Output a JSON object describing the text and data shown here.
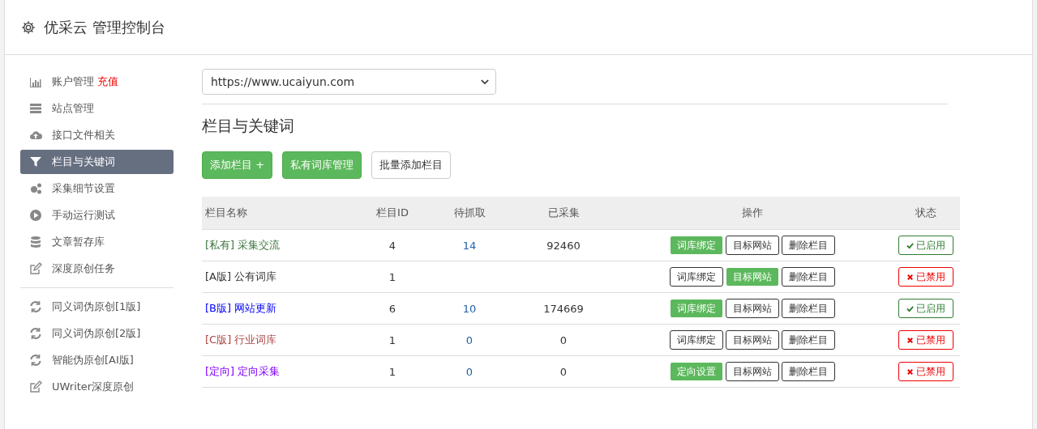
{
  "header": {
    "title": "优采云 管理控制台"
  },
  "sidebar": {
    "items": [
      {
        "label": "账户管理",
        "badge": "充值",
        "selected": false
      },
      {
        "label": "站点管理",
        "selected": false
      },
      {
        "label": "接口文件相关",
        "selected": false
      },
      {
        "label": "栏目与关键词",
        "selected": true
      },
      {
        "label": "采集细节设置",
        "selected": false
      },
      {
        "label": "手动运行测试",
        "selected": false
      },
      {
        "label": "文章暂存库",
        "selected": false
      },
      {
        "label": "深度原创任务",
        "selected": false
      }
    ],
    "tools": [
      {
        "kind": "refresh",
        "label": "同义词伪原创[1版]"
      },
      {
        "kind": "refresh",
        "label": "同义词伪原创[2版]"
      },
      {
        "kind": "refresh",
        "label": "智能伪原创[AI版]"
      },
      {
        "kind": "edit",
        "label": "UWriter深度原创"
      }
    ]
  },
  "site_select": {
    "value": "https://www.ucaiyun.com"
  },
  "section_title": "栏目与关键词",
  "toolbar": [
    {
      "label": "添加栏目 +",
      "kind": "primary"
    },
    {
      "label": "私有词库管理",
      "kind": "primary"
    },
    {
      "label": "批量添加栏目",
      "kind": "default"
    }
  ],
  "table": {
    "columns": [
      "栏目名称",
      "栏目ID",
      "待抓取",
      "已采集",
      "操作",
      "状态"
    ],
    "rows": [
      {
        "tag": "[私有]",
        "name": "采集交流",
        "color": "#3c763d",
        "id": "4",
        "pending": "14",
        "collected": "92460",
        "actions": [
          {
            "label": "词库绑定",
            "kind": "primary"
          },
          {
            "label": "目标网站",
            "kind": "default"
          },
          {
            "label": "删除栏目",
            "kind": "default"
          }
        ],
        "enabled": true,
        "status": "已启用"
      },
      {
        "tag": "[A版]",
        "name": "公有词库",
        "color": "#333333",
        "id": "1",
        "actions": [
          {
            "label": "词库绑定",
            "kind": "default"
          },
          {
            "label": "目标网站",
            "kind": "primary"
          },
          {
            "label": "删除栏目",
            "kind": "default"
          }
        ],
        "enabled": false,
        "status": "已禁用"
      },
      {
        "tag": "[B版]",
        "name": "网站更新",
        "color": "#0000ff",
        "id": "6",
        "pending": "10",
        "collected": "174669",
        "actions": [
          {
            "label": "词库绑定",
            "kind": "primary"
          },
          {
            "label": "目标网站",
            "kind": "default"
          },
          {
            "label": "删除栏目",
            "kind": "default"
          }
        ],
        "enabled": true,
        "status": "已启用"
      },
      {
        "tag": "[C版]",
        "name": "行业词库",
        "color": "#a94442",
        "id": "1",
        "pending": "0",
        "collected": "0",
        "actions": [
          {
            "label": "词库绑定",
            "kind": "default"
          },
          {
            "label": "目标网站",
            "kind": "default"
          },
          {
            "label": "删除栏目",
            "kind": "default"
          }
        ],
        "enabled": false,
        "status": "已禁用"
      },
      {
        "tag": "[定向]",
        "name": "定向采集",
        "color": "#8000ff",
        "id": "1",
        "pending": "0",
        "collected": "0",
        "actions": [
          {
            "label": "定向设置",
            "kind": "primary"
          },
          {
            "label": "目标网站",
            "kind": "default"
          },
          {
            "label": "删除栏目",
            "kind": "default"
          }
        ],
        "enabled": false,
        "status": "已禁用"
      }
    ]
  }
}
